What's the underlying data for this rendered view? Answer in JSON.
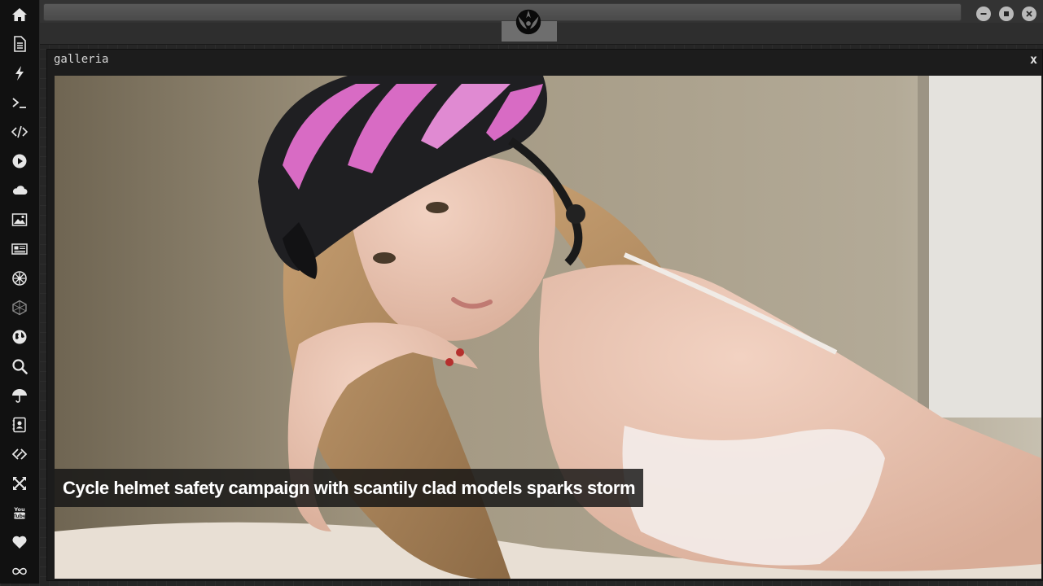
{
  "dock": {
    "items": [
      {
        "name": "home-icon"
      },
      {
        "name": "document-icon"
      },
      {
        "name": "bolt-icon"
      },
      {
        "name": "terminal-icon"
      },
      {
        "name": "code-icon"
      },
      {
        "name": "play-icon"
      },
      {
        "name": "cloud-icon"
      },
      {
        "name": "image-icon"
      },
      {
        "name": "newspaper-icon"
      },
      {
        "name": "empire-icon"
      },
      {
        "name": "hexagon-icon"
      },
      {
        "name": "globe-icon"
      },
      {
        "name": "search-icon"
      },
      {
        "name": "umbrella-icon"
      },
      {
        "name": "contacts-icon"
      },
      {
        "name": "link-icon"
      },
      {
        "name": "expand-icon"
      },
      {
        "name": "youtube-icon"
      },
      {
        "name": "heart-icon"
      },
      {
        "name": "infinity-icon"
      }
    ]
  },
  "window": {
    "title": "galleria",
    "close_label": "x"
  },
  "gallery": {
    "caption": "Cycle helmet safety campaign with scantily clad models sparks storm"
  },
  "colors": {
    "dock_bg": "#111111",
    "window_bg": "#1c1c1c",
    "caption_bg": "#141414",
    "helmet_pink": "#d86bc4"
  }
}
